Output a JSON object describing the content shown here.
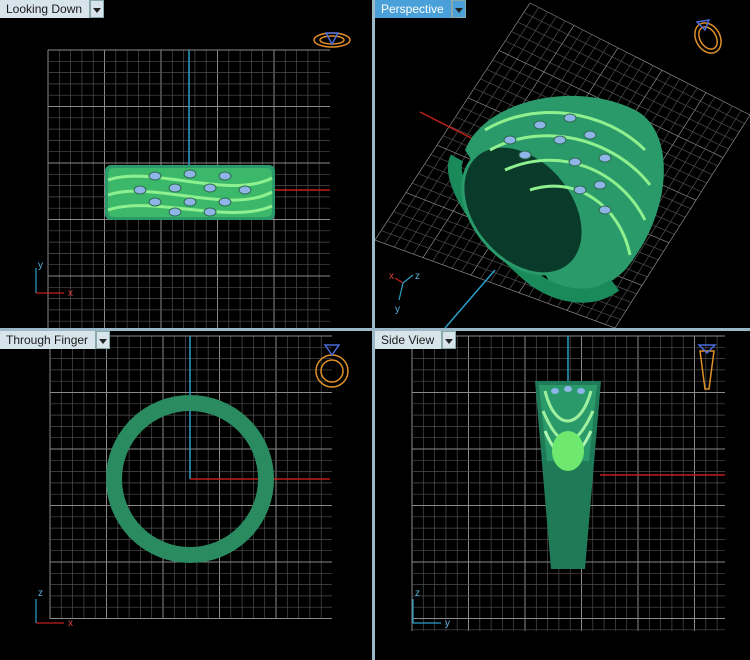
{
  "viewports": [
    {
      "label": "Looking Down",
      "active": false
    },
    {
      "label": "Perspective",
      "active": true
    },
    {
      "label": "Through Finger",
      "active": false
    },
    {
      "label": "Side View",
      "active": false
    }
  ],
  "axis_labels": {
    "top_left": [
      "y",
      "x"
    ],
    "top_right": [
      "z",
      "x",
      "y"
    ],
    "bottom_left": [
      "z",
      "x"
    ],
    "bottom_right": [
      "z",
      "y"
    ]
  },
  "colors": {
    "background": "#000000",
    "grid": "#6e6e6e",
    "ring": "#2a9a6a",
    "ring_highlight": "#7be07b",
    "gem": "#8fb4e8",
    "axis_x": "#c0201a",
    "axis_y": "#2aa0c8",
    "orientation_icon": "#e0902a",
    "active_tab": "#4aa0d8"
  }
}
